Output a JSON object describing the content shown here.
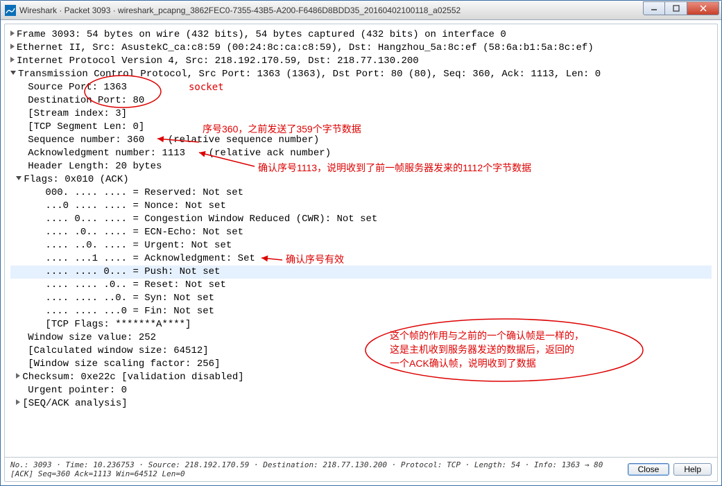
{
  "window": {
    "title": "Wireshark · Packet 3093 · wireshark_pcapng_3862FEC0-7355-43B5-A200-F6486D8BDD35_20160402100118_a02552"
  },
  "tree": {
    "frame": "Frame 3093: 54 bytes on wire (432 bits), 54 bytes captured (432 bits) on interface 0",
    "eth": "Ethernet II, Src: AsustekC_ca:c8:59 (00:24:8c:ca:c8:59), Dst: Hangzhou_5a:8c:ef (58:6a:b1:5a:8c:ef)",
    "ip": "Internet Protocol Version 4, Src: 218.192.170.59, Dst: 218.77.130.200",
    "tcp_header": "Transmission Control Protocol, Src Port: 1363 (1363), Dst Port: 80 (80), Seq: 360, Ack: 1113, Len: 0",
    "source_port": "Source Port: 1363",
    "dest_port": "Destination Port: 80",
    "stream_index": "[Stream index: 3]",
    "seg_len": "[TCP Segment Len: 0]",
    "seq": "Sequence number: 360    (relative sequence number)",
    "ack": "Acknowledgment number: 1113    (relative ack number)",
    "hdr_len": "Header Length: 20 bytes",
    "flags_header": "Flags: 0x010 (ACK)",
    "reserved": "000. .... .... = Reserved: Not set",
    "nonce": "...0 .... .... = Nonce: Not set",
    "cwr": ".... 0... .... = Congestion Window Reduced (CWR): Not set",
    "ecn": ".... .0.. .... = ECN-Echo: Not set",
    "urg": ".... ..0. .... = Urgent: Not set",
    "ackf": ".... ...1 .... = Acknowledgment: Set",
    "push": ".... .... 0... = Push: Not set",
    "reset": ".... .... .0.. = Reset: Not set",
    "syn": ".... .... ..0. = Syn: Not set",
    "fin": ".... .... ...0 = Fin: Not set",
    "tcp_flags": "[TCP Flags: *******A****]",
    "win_size": "Window size value: 252",
    "calc_win": "[Calculated window size: 64512]",
    "scale": "[Window size scaling factor: 256]",
    "checksum": "Checksum: 0xe22c [validation disabled]",
    "urg_ptr": "Urgent pointer: 0",
    "seq_ack": "[SEQ/ACK analysis]"
  },
  "annotations": {
    "socket": "socket",
    "note_seq": "序号360，之前发送了359个字节数据",
    "note_ack": "确认序号1113，说明收到了前一帧服务器发来的1112个字节数据",
    "note_ackflag": "确认序号有效",
    "note_box1": "这个帧的作用与之前的一个确认帧是一样的，",
    "note_box2": "这是主机收到服务器发送的数据后，返回的",
    "note_box3": "一个ACK确认帧，说明收到了数据"
  },
  "status": {
    "info": "No.: 3093 · Time: 10.236753 · Source: 218.192.170.59 · Destination: 218.77.130.200 · Protocol: TCP · Length: 54 · Info: 1363 → 80 [ACK] Seq=360 Ack=1113 Win=64512 Len=0"
  },
  "buttons": {
    "close": "Close",
    "help": "Help"
  }
}
